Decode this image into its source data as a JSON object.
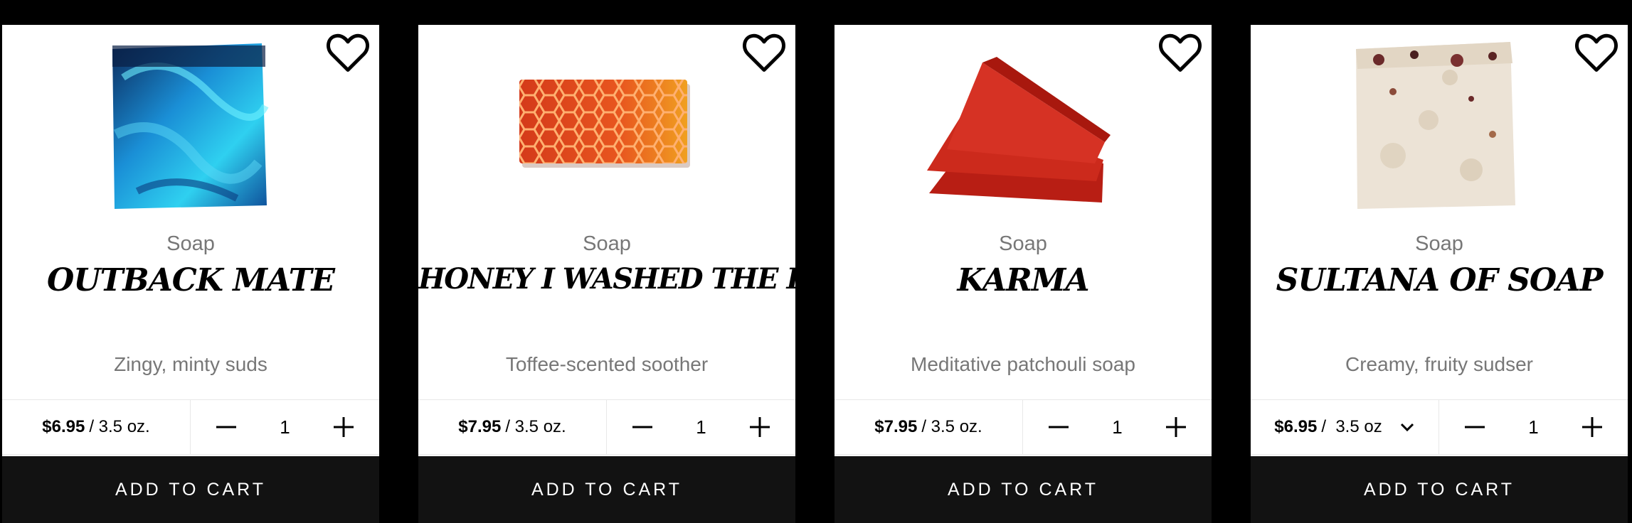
{
  "products": [
    {
      "category": "Soap",
      "name": "OUTBACK MATE",
      "description": "Zingy, minty suds",
      "price": "$6.95",
      "size": "/ 3.5 oz.",
      "quantity": "1",
      "cart_label": "ADD TO CART"
    },
    {
      "category": "Soap",
      "name": "HONEY I WASHED THE KIDS",
      "description": "Toffee-scented soother",
      "price": "$7.95",
      "size": "/ 3.5 oz.",
      "quantity": "1",
      "cart_label": "ADD TO CART"
    },
    {
      "category": "Soap",
      "name": "KARMA",
      "description": "Meditative patchouli soap",
      "price": "$7.95",
      "size": "/ 3.5 oz.",
      "quantity": "1",
      "cart_label": "ADD TO CART"
    },
    {
      "category": "Soap",
      "name": "SULTANA OF SOAP",
      "description": "Creamy, fruity sudser",
      "price": "$6.95",
      "size": "/  3.5 oz",
      "quantity": "1",
      "cart_label": "ADD TO CART",
      "has_dropdown": true
    }
  ],
  "icons": {
    "wishlist": "heart-outline-icon",
    "decrease": "minus-icon",
    "increase": "plus-icon",
    "dropdown": "chevron-down-icon"
  },
  "colors": {
    "background": "#000000",
    "card": "#ffffff",
    "cart_button": "#121212",
    "muted_text": "#777777"
  }
}
